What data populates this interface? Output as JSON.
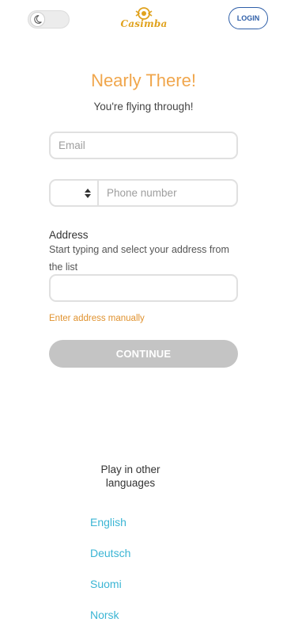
{
  "header": {
    "theme_toggle_icon": "moon-icon",
    "logo_text": "Casimba",
    "login_label": "LOGIN"
  },
  "form": {
    "title": "Nearly There!",
    "subtitle": "You're flying through!",
    "email_placeholder": "Email",
    "country_code_value": "",
    "phone_placeholder": "Phone number",
    "address_label": "Address",
    "address_help": "Start typing and select your address from the list",
    "address_value": "",
    "manual_address_link": "Enter address manually",
    "continue_label": "CONTINUE"
  },
  "languages": {
    "title": "Play in other languages",
    "items": [
      "English",
      "Deutsch",
      "Suomi",
      "Norsk"
    ]
  },
  "colors": {
    "accent_orange": "#f0a64c",
    "link_blue": "#3bb5d4",
    "login_blue": "#2f5fa8",
    "button_disabled": "#c4c4c4"
  }
}
